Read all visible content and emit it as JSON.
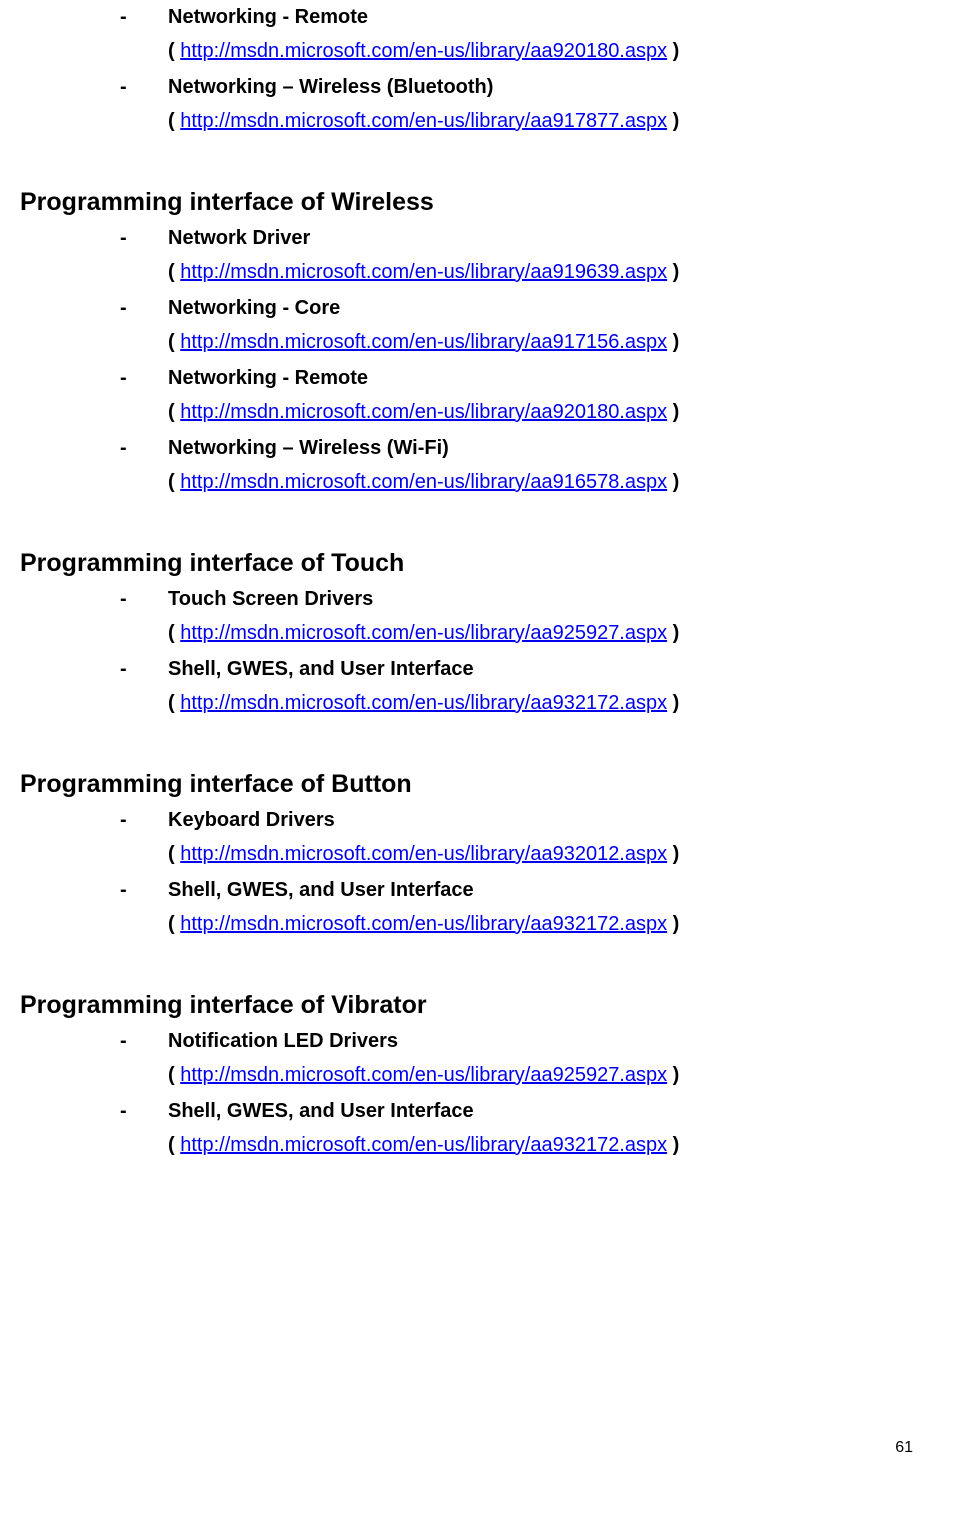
{
  "top_items": [
    {
      "label": "Networking - Remote",
      "url": "http://msdn.microsoft.com/en-us/library/aa920180.aspx"
    },
    {
      "label": "Networking – Wireless (Bluetooth)",
      "url": "http://msdn.microsoft.com/en-us/library/aa917877.aspx"
    }
  ],
  "sections": [
    {
      "heading": "Programming interface of Wireless",
      "items": [
        {
          "label": "Network Driver",
          "url": "http://msdn.microsoft.com/en-us/library/aa919639.aspx"
        },
        {
          "label": "Networking - Core",
          "url": "http://msdn.microsoft.com/en-us/library/aa917156.aspx"
        },
        {
          "label": "Networking - Remote",
          "url": "http://msdn.microsoft.com/en-us/library/aa920180.aspx"
        },
        {
          "label": "Networking – Wireless (Wi-Fi)",
          "url": "http://msdn.microsoft.com/en-us/library/aa916578.aspx"
        }
      ]
    },
    {
      "heading": "Programming interface of Touch",
      "items": [
        {
          "label": "Touch Screen Drivers",
          "url": "http://msdn.microsoft.com/en-us/library/aa925927.aspx"
        },
        {
          "label": "Shell, GWES, and User Interface",
          "url": "http://msdn.microsoft.com/en-us/library/aa932172.aspx"
        }
      ]
    },
    {
      "heading": "Programming interface of Button",
      "items": [
        {
          "label": "Keyboard Drivers",
          "url": "http://msdn.microsoft.com/en-us/library/aa932012.aspx"
        },
        {
          "label": "Shell, GWES, and User Interface",
          "url": "http://msdn.microsoft.com/en-us/library/aa932172.aspx"
        }
      ]
    },
    {
      "heading": "Programming interface of Vibrator",
      "items": [
        {
          "label": "Notification LED Drivers",
          "url": "http://msdn.microsoft.com/en-us/library/aa925927.aspx"
        },
        {
          "label": "Shell, GWES, and User Interface",
          "url": "http://msdn.microsoft.com/en-us/library/aa932172.aspx"
        }
      ]
    }
  ],
  "page_number": "61"
}
